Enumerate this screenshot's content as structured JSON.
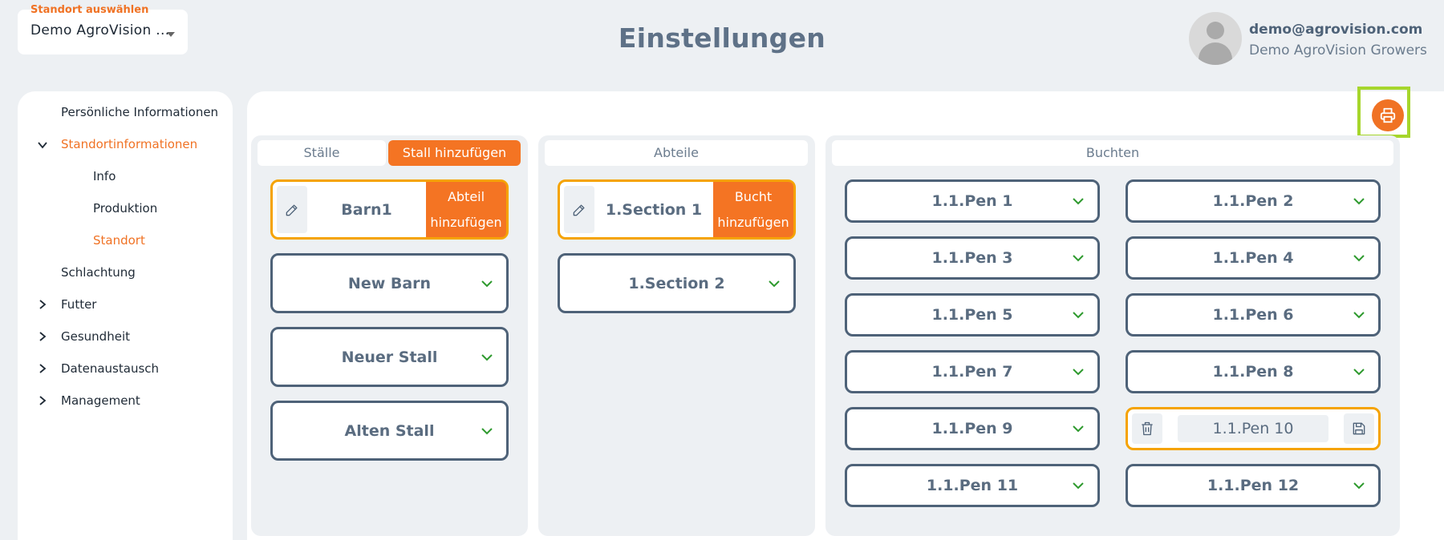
{
  "header": {
    "location_label": "Standort auswählen",
    "location_value": "Demo AgroVision ...",
    "title": "Einstellungen",
    "user_email": "demo@agrovision.com",
    "user_org": "Demo AgroVision Growers"
  },
  "sidebar": {
    "items": [
      {
        "label": "Persönliche Informationen"
      },
      {
        "label": "Standortinformationen"
      },
      {
        "label": "Info"
      },
      {
        "label": "Produktion"
      },
      {
        "label": "Standort"
      },
      {
        "label": "Schlachtung"
      },
      {
        "label": "Futter"
      },
      {
        "label": "Gesundheit"
      },
      {
        "label": "Datenaustausch"
      },
      {
        "label": "Management"
      }
    ]
  },
  "barns": {
    "header": "Ställe",
    "add_label": "Stall hinzufügen",
    "selected": {
      "label": "Barn1",
      "action": "Abteil hinzufügen"
    },
    "items": [
      "New Barn",
      "Neuer Stall",
      "Alten Stall"
    ]
  },
  "sections": {
    "header": "Abteile",
    "selected": {
      "label": "1.Section 1",
      "action": "Bucht hinzufügen"
    },
    "items": [
      "1.Section 2"
    ]
  },
  "pens": {
    "header": "Buchten",
    "items": [
      "1.1.Pen 1",
      "1.1.Pen 2",
      "1.1.Pen 3",
      "1.1.Pen 4",
      "1.1.Pen 5",
      "1.1.Pen 6",
      "1.1.Pen 7",
      "1.1.Pen 8",
      "1.1.Pen 9",
      "1.1.Pen 10",
      "1.1.Pen 11",
      "1.1.Pen 12"
    ],
    "editing_value": "1.1.Pen 10"
  },
  "colors": {
    "accent": "#f47423",
    "selected_border": "#f5a300",
    "card_border": "#4e6278",
    "chevron_green": "#2e9a2e",
    "highlight_frame": "#a6d62c"
  },
  "icons": {
    "print": "printer-icon",
    "edit": "pencil-icon",
    "delete": "trash-icon",
    "save": "floppy-disk-icon",
    "expand": "chevron-down-icon",
    "nav_expand": "chevron-right-icon"
  }
}
